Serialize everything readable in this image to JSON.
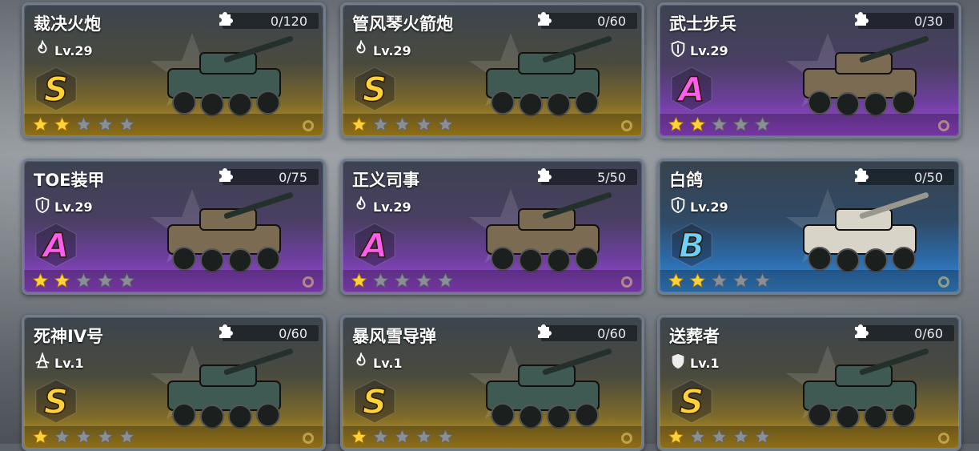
{
  "cards": [
    {
      "name": "裁决火炮",
      "level": "Lv.29",
      "fragments": "0/120",
      "rank": "S",
      "stars_filled": 2,
      "stars_total": 5,
      "class_icon": "fire-class-icon",
      "vehicle_icon": "self-propelled-artillery-truck-icon",
      "colors": {
        "accent": "#ffd23a"
      }
    },
    {
      "name": "管风琴火箭炮",
      "level": "Lv.29",
      "fragments": "0/60",
      "rank": "S",
      "stars_filled": 1,
      "stars_total": 5,
      "class_icon": "fire-class-icon",
      "vehicle_icon": "rocket-launcher-truck-icon",
      "colors": {
        "accent": "#ffd23a"
      }
    },
    {
      "name": "武士步兵",
      "level": "Lv.29",
      "fragments": "0/30",
      "rank": "A",
      "stars_filled": 2,
      "stars_total": 5,
      "class_icon": "shield-class-icon",
      "vehicle_icon": "infantry-fighting-vehicle-icon",
      "colors": {
        "accent": "#ff5cf0"
      }
    },
    {
      "name": "TOE装甲",
      "level": "Lv.29",
      "fragments": "0/75",
      "rank": "A",
      "stars_filled": 2,
      "stars_total": 5,
      "class_icon": "shield-class-icon",
      "vehicle_icon": "armored-car-icon",
      "colors": {
        "accent": "#ff5cf0"
      }
    },
    {
      "name": "正义司事",
      "level": "Lv.29",
      "fragments": "5/50",
      "rank": "A",
      "stars_filled": 1,
      "stars_total": 5,
      "class_icon": "fire-class-icon",
      "vehicle_icon": "tracked-howitzer-icon",
      "colors": {
        "accent": "#ff5cf0"
      }
    },
    {
      "name": "白鸽",
      "level": "Lv.29",
      "fragments": "0/50",
      "rank": "B",
      "stars_filled": 2,
      "stars_total": 5,
      "class_icon": "shield-class-icon",
      "vehicle_icon": "ambulance-apc-icon",
      "colors": {
        "accent": "#6fd0ff"
      }
    },
    {
      "name": "死神IV号",
      "level": "Lv.1",
      "fragments": "0/60",
      "rank": "S",
      "stars_filled": 1,
      "stars_total": 5,
      "class_icon": "assault-class-icon",
      "vehicle_icon": "heavy-gun-tracked-icon",
      "colors": {
        "accent": "#ffd23a"
      }
    },
    {
      "name": "暴风雪导弹",
      "level": "Lv.1",
      "fragments": "0/60",
      "rank": "S",
      "stars_filled": 1,
      "stars_total": 5,
      "class_icon": "fire-class-icon",
      "vehicle_icon": "missile-truck-icon",
      "colors": {
        "accent": "#ffd23a"
      }
    },
    {
      "name": "送葬者",
      "level": "Lv.1",
      "fragments": "0/60",
      "rank": "S",
      "stars_filled": 1,
      "stars_total": 5,
      "class_icon": "defense-class-icon",
      "vehicle_icon": "wheeled-gun-vehicle-icon",
      "colors": {
        "accent": "#ffd23a"
      }
    }
  ],
  "fragment_icon": "puzzle-piece-icon"
}
